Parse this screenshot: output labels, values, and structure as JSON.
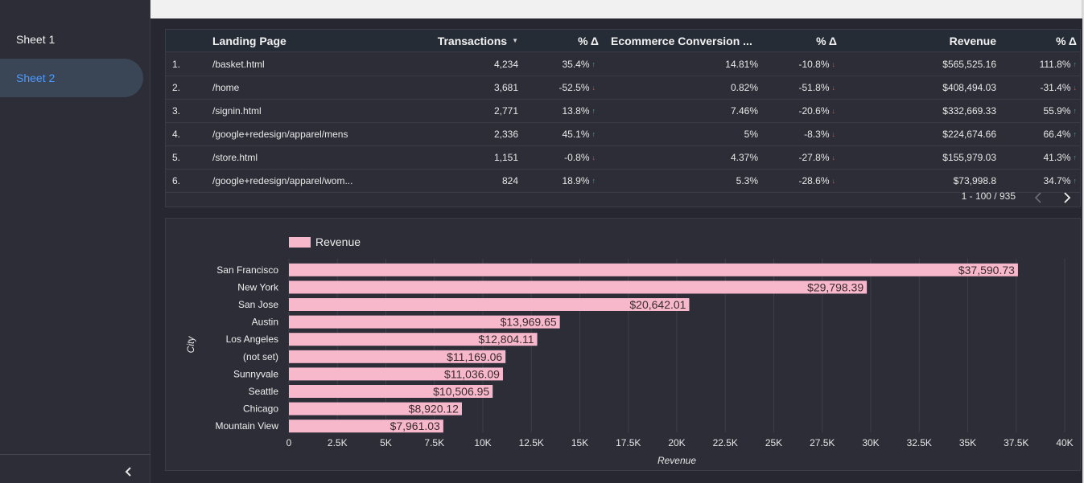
{
  "sidebar": {
    "items": [
      {
        "label": "Sheet 1",
        "active": false
      },
      {
        "label": "Sheet 2",
        "active": true
      }
    ],
    "collapse_icon": "chevron-left-icon"
  },
  "table": {
    "headers": {
      "landing_page": "Landing Page",
      "transactions": "Transactions",
      "pct1": "% Δ",
      "conversion": "Ecommerce Conversion ...",
      "pct2": "% Δ",
      "revenue": "Revenue",
      "pct3": "% Δ"
    },
    "rows": [
      {
        "n": "1.",
        "page": "/basket.html",
        "tx": "4,234",
        "d1": "35.4%",
        "d1dir": "up",
        "conv": "14.81%",
        "d2": "-10.8%",
        "d2dir": "down",
        "rev": "$565,525.16",
        "d3": "111.8%",
        "d3dir": "up"
      },
      {
        "n": "2.",
        "page": "/home",
        "tx": "3,681",
        "d1": "-52.5%",
        "d1dir": "down",
        "conv": "0.82%",
        "d2": "-51.8%",
        "d2dir": "down",
        "rev": "$408,494.03",
        "d3": "-31.4%",
        "d3dir": "down"
      },
      {
        "n": "3.",
        "page": "/signin.html",
        "tx": "2,771",
        "d1": "13.8%",
        "d1dir": "up",
        "conv": "7.46%",
        "d2": "-20.6%",
        "d2dir": "down",
        "rev": "$332,669.33",
        "d3": "55.9%",
        "d3dir": "up"
      },
      {
        "n": "4.",
        "page": "/google+redesign/apparel/mens",
        "tx": "2,336",
        "d1": "45.1%",
        "d1dir": "up",
        "conv": "5%",
        "d2": "-8.3%",
        "d2dir": "down",
        "rev": "$224,674.66",
        "d3": "66.4%",
        "d3dir": "up"
      },
      {
        "n": "5.",
        "page": "/store.html",
        "tx": "1,151",
        "d1": "-0.8%",
        "d1dir": "down",
        "conv": "4.37%",
        "d2": "-27.8%",
        "d2dir": "down",
        "rev": "$155,979.03",
        "d3": "41.3%",
        "d3dir": "up"
      },
      {
        "n": "6.",
        "page": "/google+redesign/apparel/wom...",
        "tx": "824",
        "d1": "18.9%",
        "d1dir": "up",
        "conv": "5.3%",
        "d2": "-28.6%",
        "d2dir": "down",
        "rev": "$73,998.8",
        "d3": "34.7%",
        "d3dir": "up"
      }
    ],
    "pagination": "1 - 100 / 935"
  },
  "chart_data": {
    "type": "bar",
    "orientation": "horizontal",
    "legend": "Revenue",
    "series": [
      {
        "name": "Revenue",
        "values": [
          37590.73,
          29798.39,
          20642.01,
          13969.65,
          12804.11,
          11169.06,
          11036.09,
          10506.95,
          8920.12,
          7961.03
        ]
      }
    ],
    "categories": [
      "San Francisco",
      "New York",
      "San Jose",
      "Austin",
      "Los Angeles",
      "(not set)",
      "Sunnyvale",
      "Seattle",
      "Chicago",
      "Mountain View"
    ],
    "data_labels": [
      "$37,590.73",
      "$29,798.39",
      "$20,642.01",
      "$13,969.65",
      "$12,804.11",
      "$11,169.06",
      "$11,036.09",
      "$10,506.95",
      "$8,920.12",
      "$7,961.03"
    ],
    "xlabel": "Revenue",
    "ylabel": "City",
    "xlim": [
      0,
      40000
    ],
    "xticks": [
      "0",
      "2.5K",
      "5K",
      "7.5K",
      "10K",
      "12.5K",
      "15K",
      "17.5K",
      "20K",
      "22.5K",
      "25K",
      "27.5K",
      "30K",
      "32.5K",
      "35K",
      "37.5K",
      "40K"
    ],
    "grid": "vertical",
    "bar_color": "#f7b8cc",
    "legend_position": "top-left"
  }
}
